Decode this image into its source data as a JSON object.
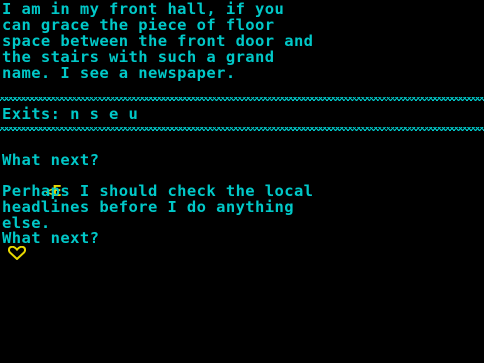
{
  "colors": {
    "background": "#000000",
    "text": "#00c8c8",
    "input": "#e8d800"
  },
  "room_description": [
    "I am in my front hall, if you",
    "can grace the piece of floor",
    "space between the front door and",
    "the stairs with such a grand",
    "name. I see a newspaper."
  ],
  "exits_line": "Exits: n s e u",
  "transcript": {
    "prompt_1": "What next?",
    "cursor_1": "<",
    "typed_command": "E",
    "response": [
      "Perhaps I should check the local",
      "headlines before I do anything",
      "else."
    ],
    "prompt_2": "What next?"
  },
  "icons": {
    "input_cursor": "heart-cursor-icon"
  }
}
